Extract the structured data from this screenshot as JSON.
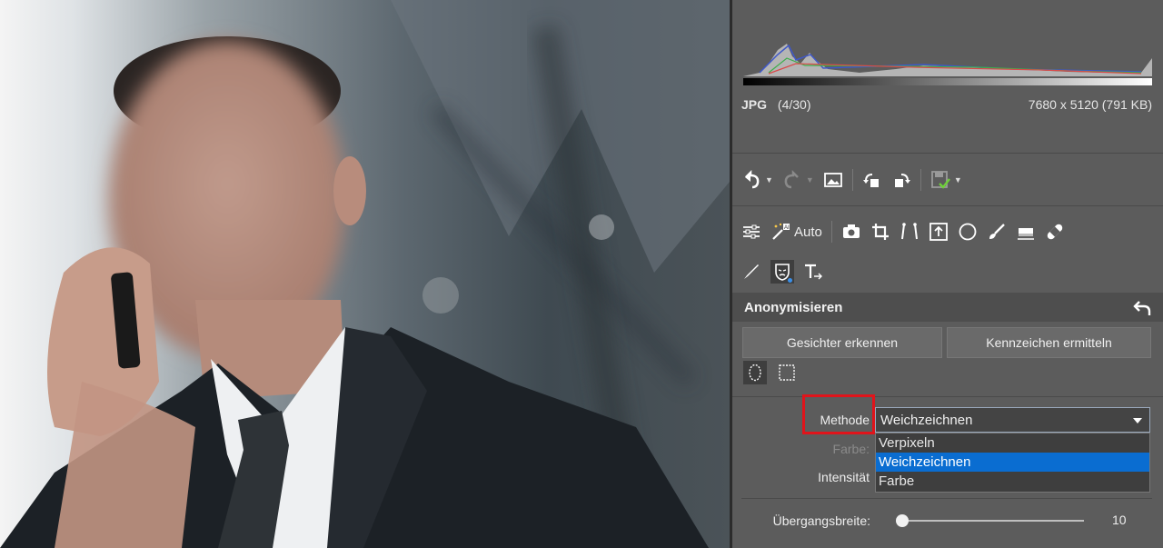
{
  "file": {
    "format": "JPG",
    "position": "(4/30)",
    "dimensions": "7680 x 5120 (791 KB)"
  },
  "toolbar_icons": [
    "undo-icon",
    "redo-icon",
    "image-icon",
    "rotate-left-icon",
    "rotate-right-icon",
    "save-icon"
  ],
  "tools": {
    "auto_label": "Auto"
  },
  "section": {
    "title": "Anonymisieren",
    "buttons": {
      "detect_faces": "Gesichter erkennen",
      "detect_plates": "Kennzeichen ermitteln"
    },
    "method_label": "Methode",
    "method_value": "Weichzeichnen",
    "method_options": [
      {
        "label": "Verpixeln",
        "selected": false
      },
      {
        "label": "Weichzeichnen",
        "selected": true
      },
      {
        "label": "Farbe",
        "selected": false
      }
    ],
    "color_label": "Farbe:",
    "intensity_label": "Intensität",
    "transition_label": "Übergangsbreite:",
    "transition_value": "10"
  },
  "colors": {
    "selection": "#0a6dd1",
    "highlight": "#e0141b",
    "panel": "#5c5c5c"
  }
}
